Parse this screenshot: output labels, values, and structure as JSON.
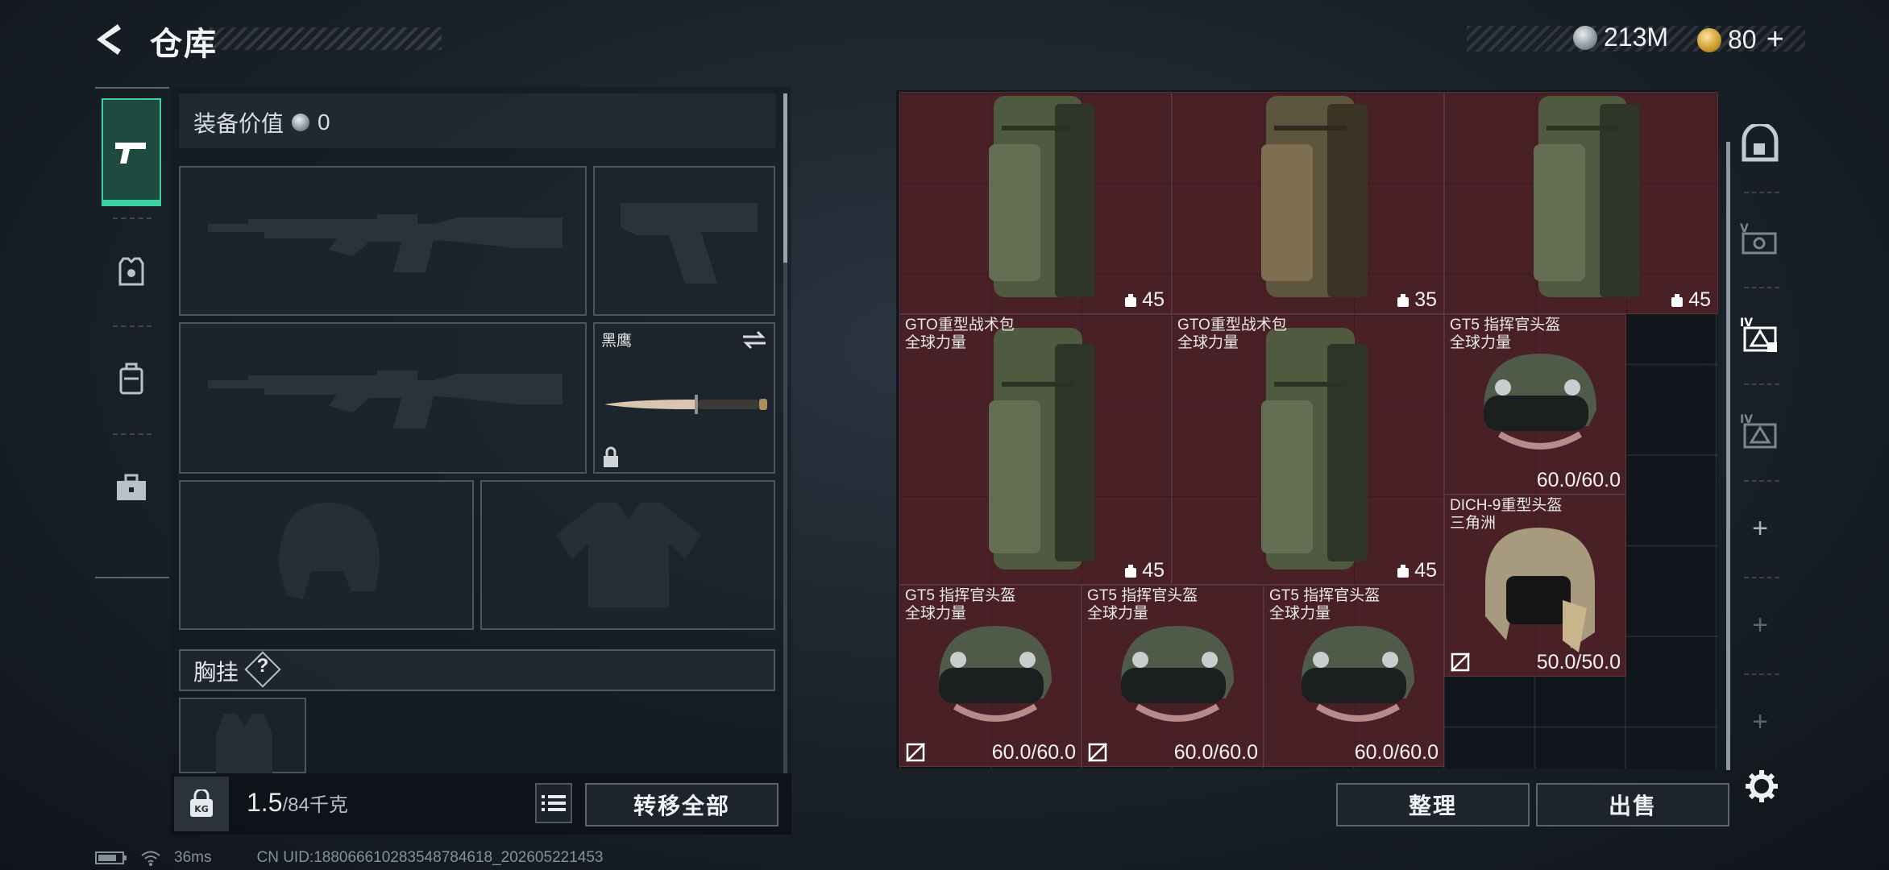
{
  "header": {
    "title": "仓库"
  },
  "currencies": [
    {
      "icon": "silver-coin-icon",
      "value": "213M"
    },
    {
      "icon": "gold-coin-icon",
      "value": "80"
    }
  ],
  "equipment": {
    "value_label": "装备价值",
    "value": "0",
    "knife_name": "黑鹰",
    "chest_label": "胸挂",
    "help": "?"
  },
  "bottom": {
    "weight_current": "1.5",
    "weight_max": "/84千克",
    "transfer_all": "转移全部",
    "organize": "整理",
    "sell": "出售"
  },
  "storage_items": [
    {
      "name": "",
      "sub": "",
      "value": "45",
      "type": "backpack"
    },
    {
      "name": "",
      "sub": "",
      "value": "35",
      "type": "backpack"
    },
    {
      "name": "",
      "sub": "",
      "value": "45",
      "type": "backpack"
    },
    {
      "name": "GTO重型战术包",
      "sub": "全球力量",
      "value": "45",
      "type": "backpack"
    },
    {
      "name": "GTO重型战术包",
      "sub": "全球力量",
      "value": "45",
      "type": "backpack"
    },
    {
      "name": "GT5 指挥官头盔",
      "sub": "全球力量",
      "value": "60.0/60.0",
      "type": "helmet"
    },
    {
      "name": "DICH-9重型头盔",
      "sub": "三角洲",
      "value": "50.0/50.0",
      "type": "helmet"
    },
    {
      "name": "GT5 指挥官头盔",
      "sub": "全球力量",
      "value": "60.0/60.0",
      "type": "helmet"
    },
    {
      "name": "GT5 指挥官头盔",
      "sub": "全球力量",
      "value": "60.0/60.0",
      "type": "helmet"
    },
    {
      "name": "GT5 指挥官头盔",
      "sub": "全球力量",
      "value": "60.0/60.0",
      "type": "helmet"
    }
  ],
  "status_bar": {
    "ping": "36ms",
    "uid": "CN UID:18806661028354878461​8_202605221453"
  },
  "colors": {
    "accent": "#3ad0a0",
    "item_bg": "#4a2027"
  }
}
